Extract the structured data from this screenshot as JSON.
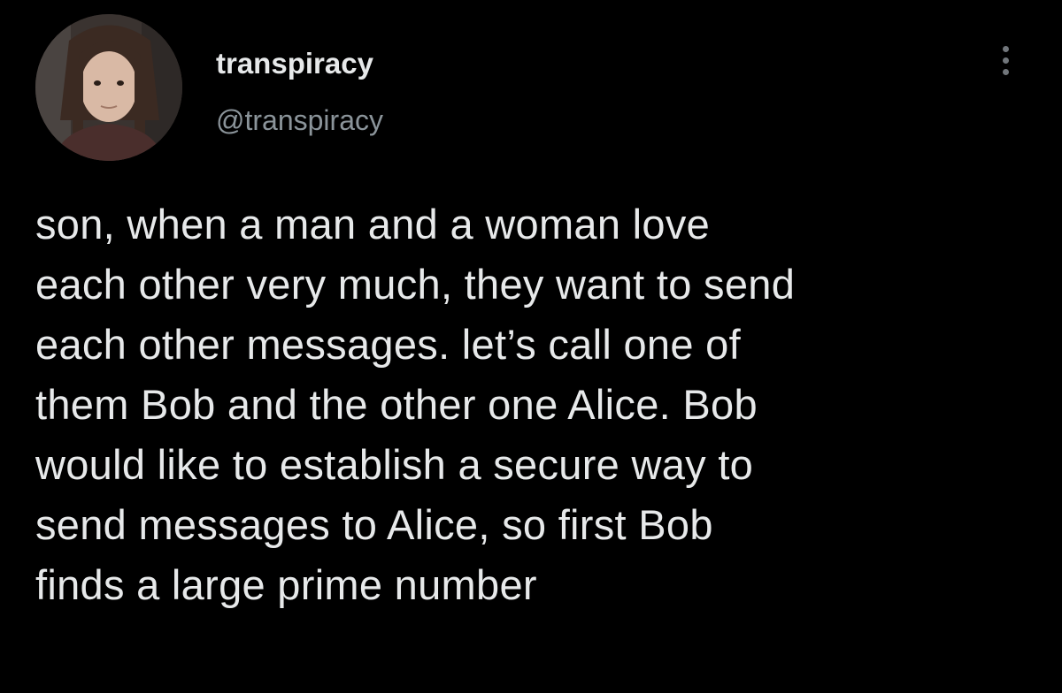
{
  "author": {
    "display_name": "transpiracy",
    "handle": "@transpiracy"
  },
  "tweet": {
    "lines": [
      "son, when a man and a woman love",
      "each other very much, they want to send",
      "each other messages. let’s call one of",
      "them Bob and the other one Alice. Bob",
      "would like to establish a secure way to",
      "send messages to Alice, so first Bob",
      "finds a large prime number"
    ]
  },
  "icons": {
    "more": "more-horizontal-icon",
    "avatar": "profile-photo"
  },
  "colors": {
    "background": "#000000",
    "text": "#e7e9ea",
    "secondary_text": "#8b949a"
  }
}
